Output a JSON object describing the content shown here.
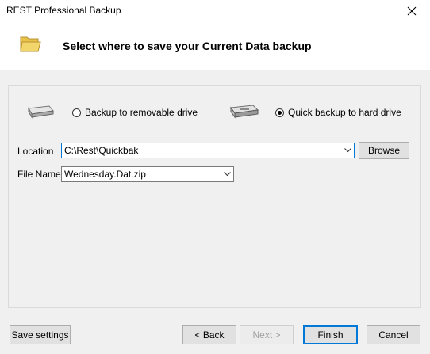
{
  "window": {
    "title": "REST Professional Backup",
    "close_glyph": "✕"
  },
  "header": {
    "title": "Select where to save your Current Data backup",
    "icon": "folder-icon"
  },
  "options": {
    "removable": {
      "label": "Backup to removable drive",
      "selected": false,
      "icon": "removable-drive-icon"
    },
    "harddrive": {
      "label": "Quick backup to hard drive",
      "selected": true,
      "icon": "hard-drive-icon"
    }
  },
  "location": {
    "label": "Location",
    "value": "C:\\Rest\\Quickbak",
    "browse_label": "Browse"
  },
  "filename": {
    "label": "File Name",
    "value": "Wednesday.Dat.zip"
  },
  "footer": {
    "save_settings": "Save settings",
    "back": "< Back",
    "next": "Next >",
    "finish": "Finish",
    "cancel": "Cancel"
  },
  "colors": {
    "accent": "#0078d7",
    "folder": "#f3d66b"
  }
}
